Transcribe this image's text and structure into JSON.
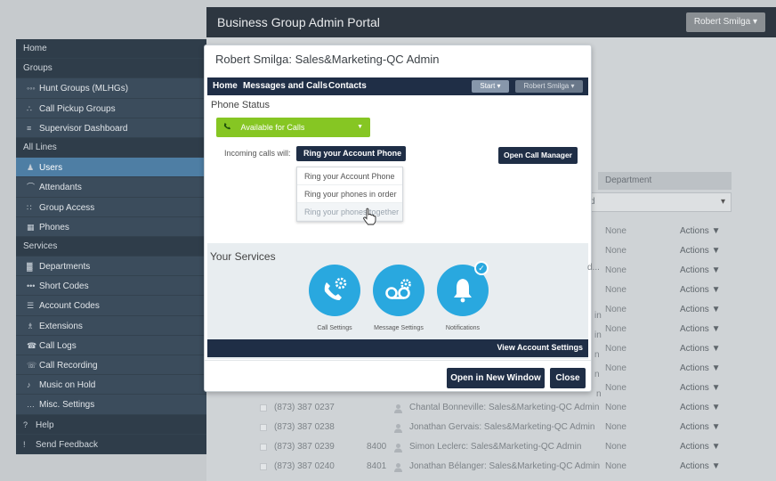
{
  "portal": {
    "title": "Business Group Admin Portal",
    "user_button": "Robert Smilga ▾"
  },
  "sidebar": {
    "items": [
      {
        "label": "Home",
        "type": "section",
        "icon": ""
      },
      {
        "label": "Groups",
        "type": "section",
        "icon": ""
      },
      {
        "label": "Hunt Groups (MLHGs)",
        "type": "link",
        "icon": "hunt-groups-icon"
      },
      {
        "label": "Call Pickup Groups",
        "type": "link",
        "icon": "pickup-groups-icon"
      },
      {
        "label": "Supervisor Dashboard",
        "type": "link",
        "icon": "dashboard-icon"
      },
      {
        "label": "All Lines",
        "type": "section",
        "icon": ""
      },
      {
        "label": "Users",
        "type": "active",
        "icon": "user-icon"
      },
      {
        "label": "Attendants",
        "type": "link",
        "icon": "attendant-icon"
      },
      {
        "label": "Group Access",
        "type": "link",
        "icon": "group-access-icon"
      },
      {
        "label": "Phones",
        "type": "link",
        "icon": "phone-grid-icon"
      },
      {
        "label": "Services",
        "type": "section",
        "icon": ""
      },
      {
        "label": "Departments",
        "type": "link",
        "icon": "departments-icon"
      },
      {
        "label": "Short Codes",
        "type": "link",
        "icon": "short-codes-icon"
      },
      {
        "label": "Account Codes",
        "type": "link",
        "icon": "account-codes-icon"
      },
      {
        "label": "Extensions",
        "type": "link",
        "icon": "extensions-icon"
      },
      {
        "label": "Call Logs",
        "type": "link",
        "icon": "call-logs-icon"
      },
      {
        "label": "Call Recording",
        "type": "link",
        "icon": "call-recording-icon"
      },
      {
        "label": "Music on Hold",
        "type": "link",
        "icon": "music-icon"
      },
      {
        "label": "Misc. Settings",
        "type": "link",
        "icon": "misc-icon"
      },
      {
        "label": "Help",
        "type": "section",
        "icon": "help-icon"
      },
      {
        "label": "Send Feedback",
        "type": "section",
        "icon": "feedback-icon"
      }
    ]
  },
  "table": {
    "dept_header": "Department",
    "dept_filter_value": "d",
    "dept_filter_arrow": "▾",
    "cut_texts": [
      "d...",
      "in",
      "in",
      "n",
      "n",
      "n"
    ],
    "rows": [
      {
        "number": "",
        "ext": "",
        "name": "",
        "dept": "None",
        "actions": "Actions ▼"
      },
      {
        "number": "",
        "ext": "",
        "name": "",
        "dept": "None",
        "actions": "Actions ▼"
      },
      {
        "number": "",
        "ext": "",
        "name": "",
        "dept": "None",
        "actions": "Actions ▼"
      },
      {
        "number": "",
        "ext": "",
        "name": "",
        "dept": "None",
        "actions": "Actions ▼"
      },
      {
        "number": "",
        "ext": "",
        "name": "",
        "dept": "None",
        "actions": "Actions ▼"
      },
      {
        "number": "",
        "ext": "",
        "name": "",
        "dept": "None",
        "actions": "Actions ▼"
      },
      {
        "number": "",
        "ext": "",
        "name": "",
        "dept": "None",
        "actions": "Actions ▼"
      },
      {
        "number": "",
        "ext": "",
        "name": "",
        "dept": "None",
        "actions": "Actions ▼"
      },
      {
        "number": "",
        "ext": "",
        "name": "",
        "dept": "None",
        "actions": "Actions ▼"
      },
      {
        "number": "(873) 387 0237",
        "ext": "",
        "name": "Chantal Bonneville: Sales&Marketing-QC Admin",
        "dept": "None",
        "actions": "Actions ▼"
      },
      {
        "number": "(873) 387 0238",
        "ext": "",
        "name": "Jonathan Gervais: Sales&Marketing-QC Admin",
        "dept": "None",
        "actions": "Actions ▼"
      },
      {
        "number": "(873) 387 0239",
        "ext": "8400",
        "name": "Simon Leclerc: Sales&Marketing-QC Admin",
        "dept": "None",
        "actions": "Actions ▼"
      },
      {
        "number": "(873) 387 0240",
        "ext": "8401",
        "name": "Jonathan Bélanger: Sales&Marketing-QC Admin",
        "dept": "None",
        "actions": "Actions ▼"
      }
    ]
  },
  "modal": {
    "title": "Robert Smilga: Sales&Marketing-QC Admin",
    "nav": {
      "home": "Home",
      "messages": "Messages and Calls",
      "contacts": "Contacts",
      "start": "Start ▾",
      "user": "Robert Smilga ▾"
    },
    "phone_status_label": "Phone Status",
    "status_button": "Available for Calls",
    "status_arrow": "▼",
    "incoming_label": "Incoming calls will:",
    "ring_select_value": "Ring your Account Phone",
    "ring_options": [
      "Ring your Account Phone",
      "Ring your phones in order",
      "Ring your phones together"
    ],
    "open_call_manager": "Open Call Manager",
    "your_services": "Your Services",
    "services": [
      {
        "label": "Call Settings",
        "icon": "call-settings-icon"
      },
      {
        "label": "Message Settings",
        "icon": "message-settings-icon"
      },
      {
        "label": "Notifications",
        "icon": "notifications-icon"
      }
    ],
    "view_account_settings": "View Account Settings",
    "open_new_window": "Open in New Window",
    "close": "Close"
  }
}
